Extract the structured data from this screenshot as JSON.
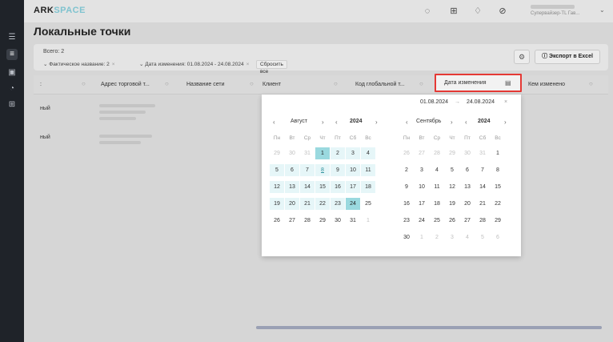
{
  "app": {
    "logo_dark": "ARK",
    "logo_light": "SPACE",
    "user_role": "Супервайзер-TL Гав..."
  },
  "page": {
    "title": "Локальные точки"
  },
  "summary": {
    "total": "Всего: 2"
  },
  "filters": [
    {
      "label": "Фактическое название: 2"
    },
    {
      "label": "Дата изменения: 01.08.2024 - 24.08.2024"
    }
  ],
  "reset_label": "Сбросить все",
  "export_label": "Экспорт в Excel",
  "columns": {
    "col0": ":",
    "col1": "Адрес торговой т...",
    "col2": "Название сети",
    "col3": "Клиент",
    "col4": "Код глобальной т...",
    "col5": "Дата изменения",
    "col6": "Кем изменено"
  },
  "rows": [
    {
      "text": "ный"
    },
    {
      "text": "ный"
    }
  ],
  "datepicker": {
    "start": "01.08.2024",
    "sep": "→",
    "end": "24.08.2024",
    "left": {
      "month": "Август",
      "year": "2024"
    },
    "right": {
      "month": "Сентябрь",
      "year": "2024"
    },
    "weekdays": [
      "Пн",
      "Вт",
      "Ср",
      "Чт",
      "Пт",
      "Сб",
      "Вс"
    ],
    "left_days": [
      [
        "29",
        "30",
        "31",
        "1",
        "2",
        "3",
        "4"
      ],
      [
        "5",
        "6",
        "7",
        "8",
        "9",
        "10",
        "11"
      ],
      [
        "12",
        "13",
        "14",
        "15",
        "16",
        "17",
        "18"
      ],
      [
        "19",
        "20",
        "21",
        "22",
        "23",
        "24",
        "25"
      ],
      [
        "26",
        "27",
        "28",
        "29",
        "30",
        "31",
        "1"
      ]
    ],
    "right_days": [
      [
        "26",
        "27",
        "28",
        "29",
        "30",
        "31",
        "1"
      ],
      [
        "2",
        "3",
        "4",
        "5",
        "6",
        "7",
        "8"
      ],
      [
        "9",
        "10",
        "11",
        "12",
        "13",
        "14",
        "15"
      ],
      [
        "16",
        "17",
        "18",
        "19",
        "20",
        "21",
        "22"
      ],
      [
        "23",
        "24",
        "25",
        "26",
        "27",
        "28",
        "29"
      ],
      [
        "30",
        "1",
        "2",
        "3",
        "4",
        "5",
        "6"
      ]
    ]
  },
  "icons": {
    "close": "×",
    "arrow_left": "‹",
    "arrow_right": "›",
    "dbl_left": "«",
    "dbl_right": "»"
  }
}
